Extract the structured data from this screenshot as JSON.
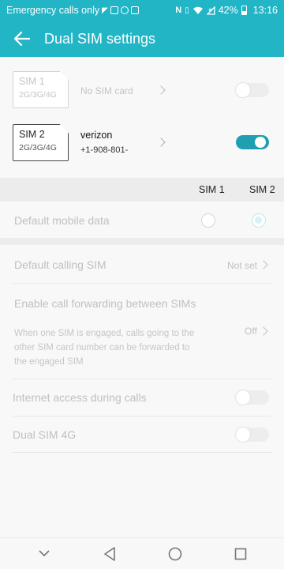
{
  "status_bar": {
    "carrier_text": "Emergency calls only",
    "battery": "42%",
    "time": "13:16",
    "icons": [
      "nfc-icon",
      "vibrate-icon",
      "wifi-icon",
      "no-signal-icon",
      "battery-icon"
    ]
  },
  "header": {
    "title": "Dual SIM settings"
  },
  "sim1": {
    "name": "SIM 1",
    "bands": "2G/3G/4G",
    "status": "No SIM card",
    "enabled": false
  },
  "sim2": {
    "name": "SIM 2",
    "bands": "2G/3G/4G",
    "carrier": "verizon",
    "number": "+1-908-801-",
    "enabled": true
  },
  "columns": {
    "sim1": "SIM 1",
    "sim2": "SIM 2"
  },
  "settings": {
    "default_mobile_data": {
      "label": "Default mobile data",
      "selected": "SIM 2"
    },
    "default_calling_sim": {
      "label": "Default calling SIM",
      "value": "Not set"
    },
    "call_forwarding": {
      "label": "Enable call forwarding between SIMs",
      "description": "When one SIM is engaged, calls going to the other SIM card number can be forwarded to the engaged SIM",
      "value": "Off"
    },
    "internet_during_calls": {
      "label": "Internet access during calls",
      "enabled": false
    },
    "dual_sim_4g": {
      "label": "Dual SIM 4G",
      "enabled": false
    }
  },
  "colors": {
    "accent": "#22b5c6",
    "toggle_on": "#1f9fb1"
  }
}
